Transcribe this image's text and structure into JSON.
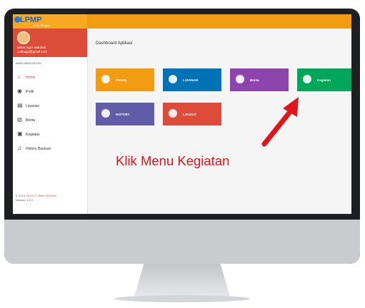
{
  "app": {
    "logo_text": "LPMP",
    "logo_subtext": "Jawa Tengah"
  },
  "sidebar": {
    "user_name": "Sirius Agus Mardani",
    "user_email": "codkagu@gmail.com",
    "nav_header": "MAIN NAVIGATION",
    "items": [
      {
        "label": "Home",
        "icon": "home-icon",
        "glyph": "⌂"
      },
      {
        "label": "Profil",
        "icon": "user-icon",
        "glyph": "◉"
      },
      {
        "label": "Layanan",
        "icon": "list-icon",
        "glyph": "▤"
      },
      {
        "label": "Berita",
        "icon": "globe-icon",
        "glyph": "◍"
      },
      {
        "label": "Kegiatan",
        "icon": "clipboard-icon",
        "glyph": "▣"
      },
      {
        "label": "History Bantuan",
        "icon": "history-icon",
        "glyph": "♫"
      }
    ],
    "copyright": "© 2019 TIM ICT LPMP JATENG",
    "version": "Version: 1.0.0"
  },
  "content": {
    "title": "Dashboard Aplikasi",
    "tiles": [
      {
        "label": "PROFIL",
        "color": "#f39c12",
        "icon": "user-icon"
      },
      {
        "label": "LAYANAN",
        "color": "#0073b7",
        "icon": "id-card-icon"
      },
      {
        "label": "Berita",
        "color": "#8e44ad",
        "icon": "info-icon"
      },
      {
        "label": "Kegiatan",
        "color": "#00a65a",
        "icon": "clipboard-icon"
      },
      {
        "label": "HISTORY",
        "color": "#605ca8",
        "icon": "users-icon"
      },
      {
        "label": "LOGOUT",
        "color": "#dd4b39",
        "icon": "power-icon"
      }
    ]
  },
  "annotation": {
    "caption": "Klik Menu Kegiatan",
    "color": "#e0141a"
  }
}
